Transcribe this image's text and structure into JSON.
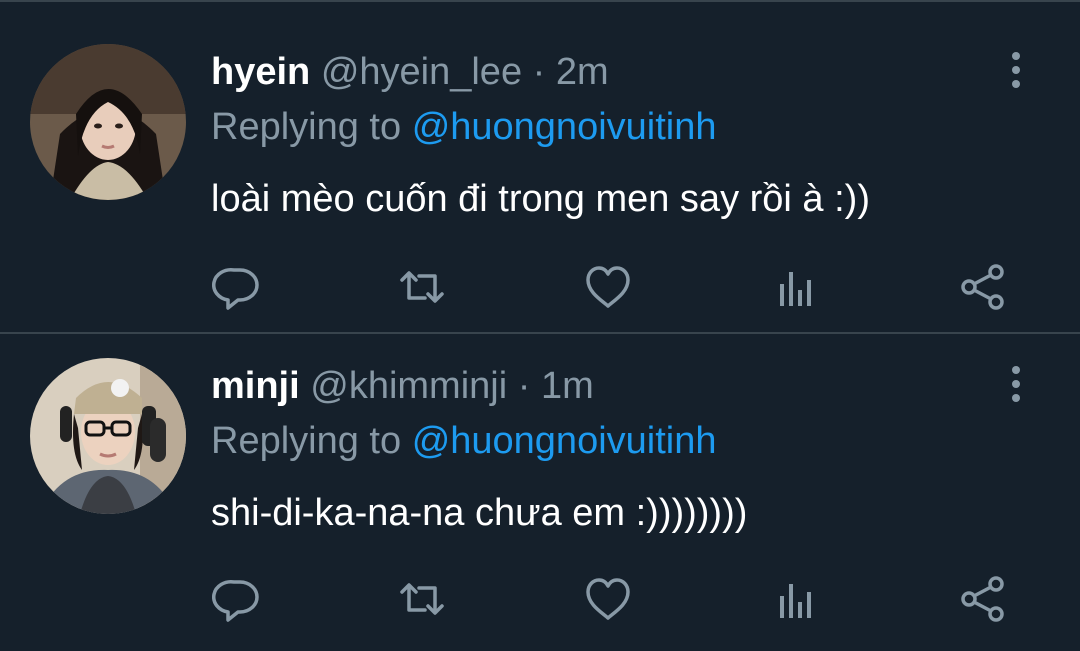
{
  "colors": {
    "background": "#15202b",
    "divider": "#38444d",
    "secondary_text": "#8899a6",
    "mention": "#1d9bf0",
    "primary_text": "#ffffff"
  },
  "tweets": [
    {
      "display_name": "hyein",
      "handle": "@hyein_lee",
      "separator": "·",
      "time": "2m",
      "replying_prefix": "Replying to",
      "replying_to": "@huongnoivuitinh",
      "text": "loài mèo cuốn đi trong men say rồi à :))",
      "icons": [
        "reply-icon",
        "retweet-icon",
        "like-icon",
        "views-icon",
        "share-icon",
        "more-options-icon"
      ]
    },
    {
      "display_name": "minji",
      "handle": "@khimminji",
      "separator": "·",
      "time": "1m",
      "replying_prefix": "Replying to",
      "replying_to": "@huongnoivuitinh",
      "text": "shi-di-ka-na-na chưa em :))))))))",
      "icons": [
        "reply-icon",
        "retweet-icon",
        "like-icon",
        "views-icon",
        "share-icon",
        "more-options-icon"
      ]
    }
  ]
}
